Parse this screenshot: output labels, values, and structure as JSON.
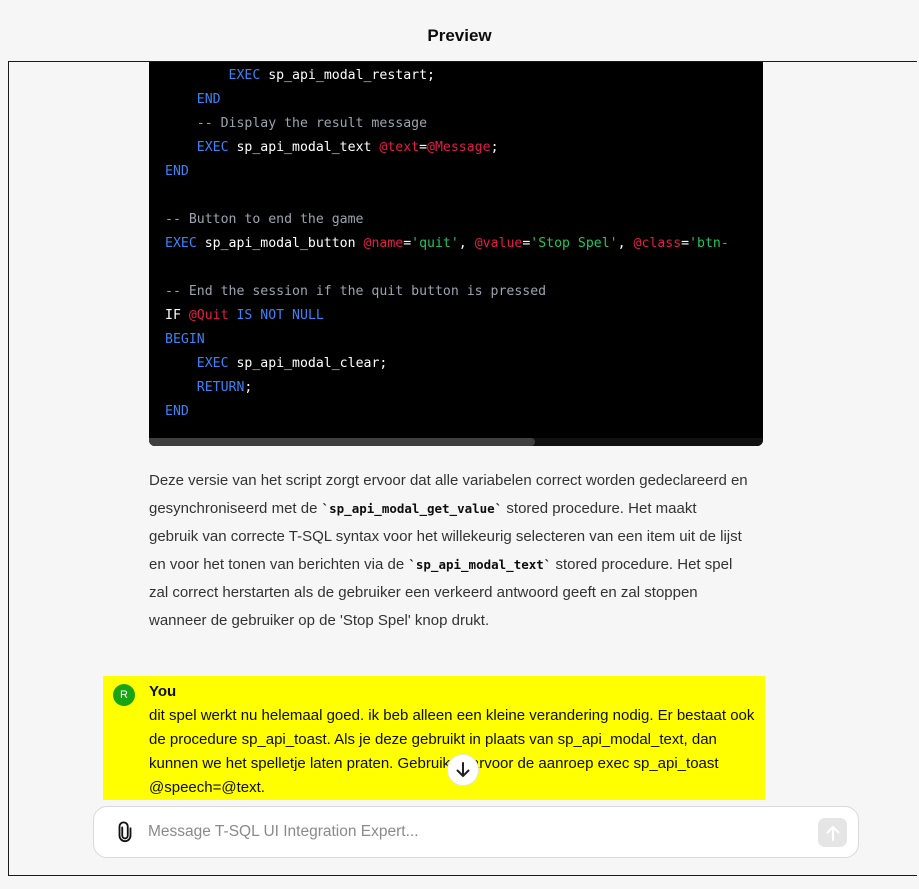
{
  "header": {
    "title": "Preview"
  },
  "code_lines": [
    [
      {
        "t": "        "
      },
      {
        "t": "EXEC",
        "c": "kw"
      },
      {
        "t": " sp_api_modal_restart;"
      }
    ],
    [
      {
        "t": "    "
      },
      {
        "t": "END",
        "c": "kw"
      }
    ],
    [
      {
        "t": "    "
      },
      {
        "t": "-- Display the result message",
        "c": "cm"
      }
    ],
    [
      {
        "t": "    "
      },
      {
        "t": "EXEC",
        "c": "kw"
      },
      {
        "t": " sp_api_modal_text "
      },
      {
        "t": "@text",
        "c": "var"
      },
      {
        "t": "="
      },
      {
        "t": "@Message",
        "c": "var"
      },
      {
        "t": ";"
      }
    ],
    [
      {
        "t": "END",
        "c": "kw"
      }
    ],
    [
      {
        "t": ""
      }
    ],
    [
      {
        "t": "-- Button to end the game",
        "c": "cm"
      }
    ],
    [
      {
        "t": "EXEC",
        "c": "kw"
      },
      {
        "t": " sp_api_modal_button "
      },
      {
        "t": "@name",
        "c": "var"
      },
      {
        "t": "="
      },
      {
        "t": "'quit'",
        "c": "str"
      },
      {
        "t": ", "
      },
      {
        "t": "@value",
        "c": "var"
      },
      {
        "t": "="
      },
      {
        "t": "'Stop Spel'",
        "c": "str"
      },
      {
        "t": ", "
      },
      {
        "t": "@class",
        "c": "var"
      },
      {
        "t": "="
      },
      {
        "t": "'btn-",
        "c": "str"
      }
    ],
    [
      {
        "t": ""
      }
    ],
    [
      {
        "t": "-- End the session if the quit button is pressed",
        "c": "cm"
      }
    ],
    [
      {
        "t": "IF "
      },
      {
        "t": "@Quit",
        "c": "var"
      },
      {
        "t": " "
      },
      {
        "t": "IS NOT NULL",
        "c": "kw"
      }
    ],
    [
      {
        "t": "BEGIN",
        "c": "kw"
      }
    ],
    [
      {
        "t": "    "
      },
      {
        "t": "EXEC",
        "c": "kw"
      },
      {
        "t": " sp_api_modal_clear;"
      }
    ],
    [
      {
        "t": "    "
      },
      {
        "t": "RETURN",
        "c": "kw"
      },
      {
        "t": ";"
      }
    ],
    [
      {
        "t": "END",
        "c": "kw"
      }
    ]
  ],
  "assistant_paragraph": [
    {
      "t": "Deze versie van het script zorgt ervoor dat alle variabelen correct worden gedeclareerd en gesynchroniseerd met de "
    },
    {
      "t": "`sp_api_modal_get_value`",
      "code": true
    },
    {
      "t": " stored procedure. Het maakt gebruik van correcte T-SQL syntax voor het willekeurig selecteren van een item uit de lijst en voor het tonen van berichten via de "
    },
    {
      "t": "`sp_api_modal_text`",
      "code": true
    },
    {
      "t": " stored procedure. Het spel zal correct herstarten als de gebruiker een verkeerd antwoord geeft en zal stoppen wanneer de gebruiker op de 'Stop Spel' knop drukt."
    }
  ],
  "user_message": {
    "avatar_letter": "R",
    "name": "You",
    "text": "dit spel werkt nu helemaal goed. ik beb alleen een kleine verandering nodig. Er bestaat ook de procedure sp_api_toast. Als je deze gebruikt in plaats van sp_api_modal_text, dan kunnen we het spelletje laten praten. Gebruik daarvoor de aanroep exec sp_api_toast @speech=@text."
  },
  "composer": {
    "placeholder": "Message T-SQL UI Integration Expert..."
  },
  "icons": {
    "attach": "paperclip-icon",
    "send": "arrow-up-icon",
    "scroll": "arrow-down-icon"
  },
  "colors": {
    "highlight": "#ffff00",
    "avatar": "#19a413",
    "keyword": "#3b82f6",
    "variable": "#e11d48",
    "string": "#22c55e",
    "comment": "#9ca3af"
  }
}
